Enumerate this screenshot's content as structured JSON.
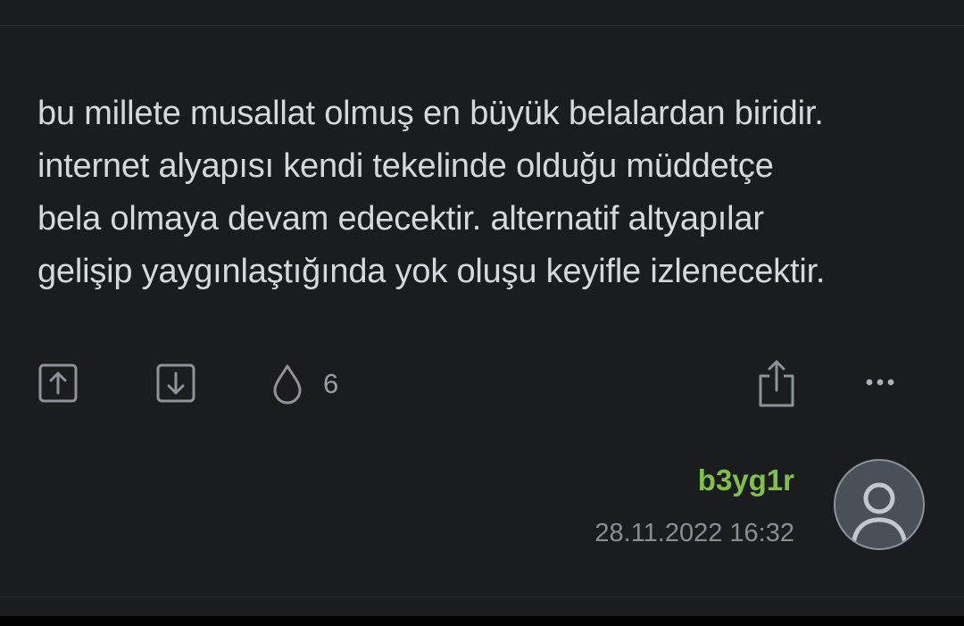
{
  "entry": {
    "lines": [
      "bu millete musallat olmuş en büyük belalardan biridir.",
      "internet alyapısı kendi tekelinde olduğu müddetçe",
      "bela olmaya devam edecektir. alternatif altyapılar",
      "gelişip yaygınlaştığında yok oluşu keyifle izlenecektir."
    ]
  },
  "actions": {
    "upvote_icon": "arrow-up-square-icon",
    "downvote_icon": "arrow-down-square-icon",
    "favorite_icon": "drop-icon",
    "favorite_count": "6",
    "share_icon": "share-icon",
    "more_icon": "more-horizontal-icon"
  },
  "author": {
    "name": "b3yg1r",
    "date": "28.11.2022 16:32",
    "avatar_icon": "user-avatar-icon"
  },
  "colors": {
    "background": "#1b1c1e",
    "text": "#d6d8dc",
    "author": "#81c14b",
    "muted": "#8a8e94"
  }
}
